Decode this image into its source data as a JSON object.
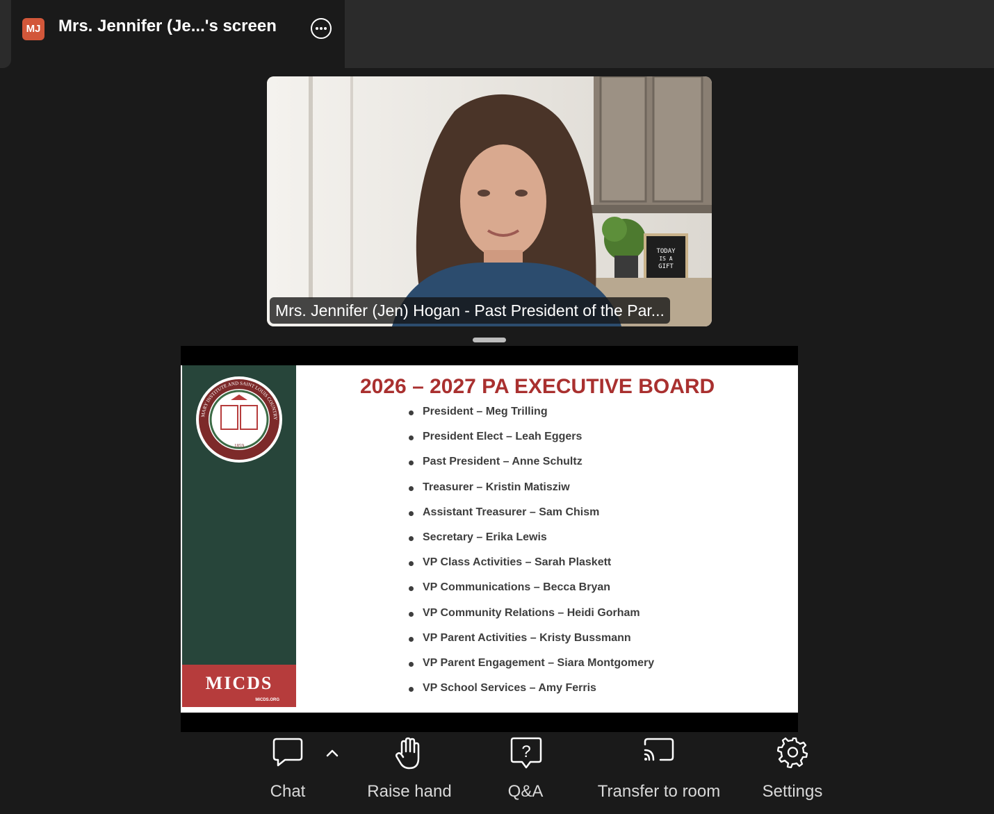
{
  "window": {
    "avatar_initials": "MJ",
    "avatar_color": "#d2573a",
    "title": "Mrs. Jennifer (Je...'s screen",
    "more_icon": "more-options-icon"
  },
  "video": {
    "participant_name": "Mrs. Jennifer (Jen) Hogan - Past President of the Par...",
    "background_sign_text": "TODAY IS A GIFT"
  },
  "slide": {
    "title": "2026 – 2027 PA EXECUTIVE BOARD",
    "title_color": "#a9302f",
    "logo_text": "MICDS",
    "logo_url": "MICDS.ORG",
    "seal_text": "MARY INSTITUTE AND SAINT LOUIS COUNTRY DAY SCHOOL",
    "seal_year": "1859",
    "members": [
      "President – Meg Trilling",
      "President Elect – Leah Eggers",
      "Past President – Anne Schultz",
      "Treasurer – Kristin Matisziw",
      "Assistant Treasurer – Sam Chism",
      "Secretary – Erika Lewis",
      "VP Class Activities – Sarah Plaskett",
      "VP Communications – Becca Bryan",
      "VP Community Relations – Heidi Gorham",
      "VP Parent Activities – Kristy Bussmann",
      "VP Parent Engagement – Siara Montgomery",
      "VP School Services – Amy Ferris"
    ]
  },
  "toolbar": {
    "chat": "Chat",
    "raise_hand": "Raise hand",
    "qa": "Q&A",
    "transfer": "Transfer to room",
    "settings": "Settings"
  }
}
